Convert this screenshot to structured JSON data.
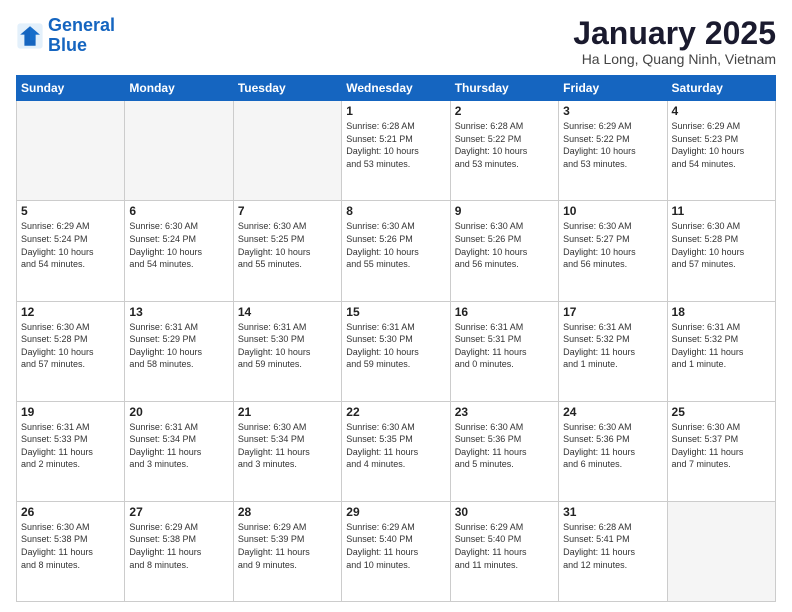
{
  "header": {
    "logo_line1": "General",
    "logo_line2": "Blue",
    "month_title": "January 2025",
    "location": "Ha Long, Quang Ninh, Vietnam"
  },
  "weekdays": [
    "Sunday",
    "Monday",
    "Tuesday",
    "Wednesday",
    "Thursday",
    "Friday",
    "Saturday"
  ],
  "weeks": [
    [
      {
        "num": "",
        "info": ""
      },
      {
        "num": "",
        "info": ""
      },
      {
        "num": "",
        "info": ""
      },
      {
        "num": "1",
        "info": "Sunrise: 6:28 AM\nSunset: 5:21 PM\nDaylight: 10 hours\nand 53 minutes."
      },
      {
        "num": "2",
        "info": "Sunrise: 6:28 AM\nSunset: 5:22 PM\nDaylight: 10 hours\nand 53 minutes."
      },
      {
        "num": "3",
        "info": "Sunrise: 6:29 AM\nSunset: 5:22 PM\nDaylight: 10 hours\nand 53 minutes."
      },
      {
        "num": "4",
        "info": "Sunrise: 6:29 AM\nSunset: 5:23 PM\nDaylight: 10 hours\nand 54 minutes."
      }
    ],
    [
      {
        "num": "5",
        "info": "Sunrise: 6:29 AM\nSunset: 5:24 PM\nDaylight: 10 hours\nand 54 minutes."
      },
      {
        "num": "6",
        "info": "Sunrise: 6:30 AM\nSunset: 5:24 PM\nDaylight: 10 hours\nand 54 minutes."
      },
      {
        "num": "7",
        "info": "Sunrise: 6:30 AM\nSunset: 5:25 PM\nDaylight: 10 hours\nand 55 minutes."
      },
      {
        "num": "8",
        "info": "Sunrise: 6:30 AM\nSunset: 5:26 PM\nDaylight: 10 hours\nand 55 minutes."
      },
      {
        "num": "9",
        "info": "Sunrise: 6:30 AM\nSunset: 5:26 PM\nDaylight: 10 hours\nand 56 minutes."
      },
      {
        "num": "10",
        "info": "Sunrise: 6:30 AM\nSunset: 5:27 PM\nDaylight: 10 hours\nand 56 minutes."
      },
      {
        "num": "11",
        "info": "Sunrise: 6:30 AM\nSunset: 5:28 PM\nDaylight: 10 hours\nand 57 minutes."
      }
    ],
    [
      {
        "num": "12",
        "info": "Sunrise: 6:30 AM\nSunset: 5:28 PM\nDaylight: 10 hours\nand 57 minutes."
      },
      {
        "num": "13",
        "info": "Sunrise: 6:31 AM\nSunset: 5:29 PM\nDaylight: 10 hours\nand 58 minutes."
      },
      {
        "num": "14",
        "info": "Sunrise: 6:31 AM\nSunset: 5:30 PM\nDaylight: 10 hours\nand 59 minutes."
      },
      {
        "num": "15",
        "info": "Sunrise: 6:31 AM\nSunset: 5:30 PM\nDaylight: 10 hours\nand 59 minutes."
      },
      {
        "num": "16",
        "info": "Sunrise: 6:31 AM\nSunset: 5:31 PM\nDaylight: 11 hours\nand 0 minutes."
      },
      {
        "num": "17",
        "info": "Sunrise: 6:31 AM\nSunset: 5:32 PM\nDaylight: 11 hours\nand 1 minute."
      },
      {
        "num": "18",
        "info": "Sunrise: 6:31 AM\nSunset: 5:32 PM\nDaylight: 11 hours\nand 1 minute."
      }
    ],
    [
      {
        "num": "19",
        "info": "Sunrise: 6:31 AM\nSunset: 5:33 PM\nDaylight: 11 hours\nand 2 minutes."
      },
      {
        "num": "20",
        "info": "Sunrise: 6:31 AM\nSunset: 5:34 PM\nDaylight: 11 hours\nand 3 minutes."
      },
      {
        "num": "21",
        "info": "Sunrise: 6:30 AM\nSunset: 5:34 PM\nDaylight: 11 hours\nand 3 minutes."
      },
      {
        "num": "22",
        "info": "Sunrise: 6:30 AM\nSunset: 5:35 PM\nDaylight: 11 hours\nand 4 minutes."
      },
      {
        "num": "23",
        "info": "Sunrise: 6:30 AM\nSunset: 5:36 PM\nDaylight: 11 hours\nand 5 minutes."
      },
      {
        "num": "24",
        "info": "Sunrise: 6:30 AM\nSunset: 5:36 PM\nDaylight: 11 hours\nand 6 minutes."
      },
      {
        "num": "25",
        "info": "Sunrise: 6:30 AM\nSunset: 5:37 PM\nDaylight: 11 hours\nand 7 minutes."
      }
    ],
    [
      {
        "num": "26",
        "info": "Sunrise: 6:30 AM\nSunset: 5:38 PM\nDaylight: 11 hours\nand 8 minutes."
      },
      {
        "num": "27",
        "info": "Sunrise: 6:29 AM\nSunset: 5:38 PM\nDaylight: 11 hours\nand 8 minutes."
      },
      {
        "num": "28",
        "info": "Sunrise: 6:29 AM\nSunset: 5:39 PM\nDaylight: 11 hours\nand 9 minutes."
      },
      {
        "num": "29",
        "info": "Sunrise: 6:29 AM\nSunset: 5:40 PM\nDaylight: 11 hours\nand 10 minutes."
      },
      {
        "num": "30",
        "info": "Sunrise: 6:29 AM\nSunset: 5:40 PM\nDaylight: 11 hours\nand 11 minutes."
      },
      {
        "num": "31",
        "info": "Sunrise: 6:28 AM\nSunset: 5:41 PM\nDaylight: 11 hours\nand 12 minutes."
      },
      {
        "num": "",
        "info": ""
      }
    ]
  ]
}
